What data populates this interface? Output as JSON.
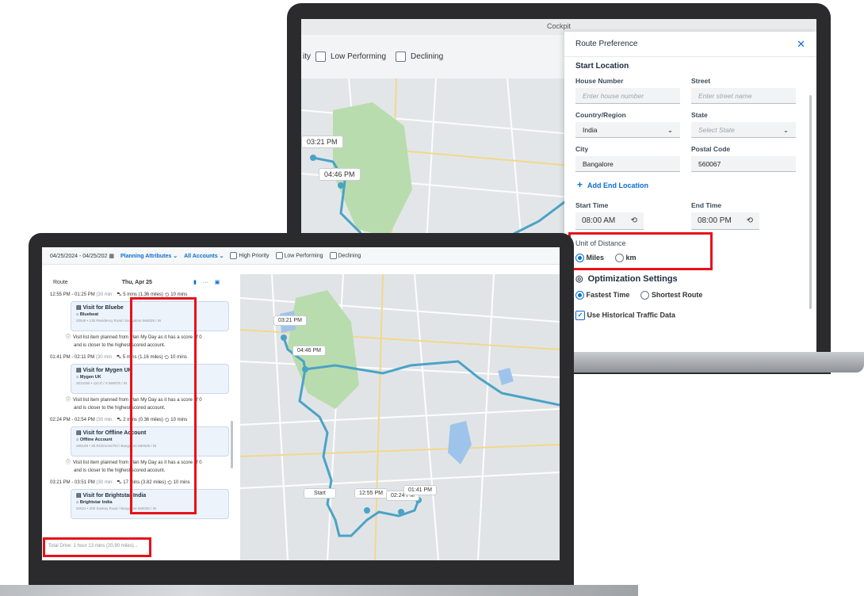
{
  "back": {
    "window_title": "Cockpit",
    "filters": [
      "ity",
      "Low Performing",
      "Declining"
    ],
    "map_pins": [
      "03:21 PM",
      "04:46 PM"
    ],
    "panel": {
      "title": "Route Preference",
      "close_icon": "close-icon",
      "start_location": "Start Location",
      "house_number_label": "House Number",
      "house_number_placeholder": "Enter house number",
      "street_label": "Street",
      "street_placeholder": "Enter street name",
      "country_label": "Country/Region",
      "country_value": "India",
      "state_label": "State",
      "state_placeholder": "Select State",
      "city_label": "City",
      "city_value": "Bangalore",
      "postal_label": "Postal Code",
      "postal_value": "560067",
      "add_end": "Add End Location",
      "start_time_label": "Start Time",
      "start_time_value": "08:00 AM",
      "end_time_label": "End Time",
      "end_time_value": "08:00 PM",
      "unit_label": "Unit of Distance",
      "unit_miles": "Miles",
      "unit_km": "km",
      "unit_selected": "Miles",
      "opt_title": "Optimization Settings",
      "fastest": "Fastest Time",
      "shortest": "Shortest Route",
      "opt_selected": "Fastest Time",
      "historical": "Use Historical Traffic Data",
      "historical_checked": true
    }
  },
  "front": {
    "toolbar": {
      "date_range": "04/25/2024 - 04/25/202",
      "planning": "Planning Attributes",
      "accounts": "All Accounts",
      "high": "High Priority",
      "low": "Low Performing",
      "declining": "Declining"
    },
    "route": {
      "label": "Route",
      "date": "Thu, Apr 25",
      "segments": [
        {
          "time": "12:55 PM - 01:25 PM",
          "dur": "(30 min",
          "drive": "5 mins (1.36 miles)",
          "wait": "10 mins",
          "title": "Visit for Bluebe",
          "account": "Bluebeat",
          "addr": "20546 • 135 Residency Road / Bangalore 560025 / IN",
          "note1": "Visit list item planned from Plan My Day as it has a score of 0",
          "note2": "and is closer to the highest scored account."
        },
        {
          "time": "01:41 PM - 02:11 PM",
          "dur": "(30 min",
          "drive": "5 mins (1.16 miles)",
          "wait": "10 mins",
          "title": "Visit for Mygen UK",
          "account": "Mygen UK",
          "addr": "3012250 • 110 E / S 560076 / IN",
          "note1": "Visit list item planned from Plan My Day as it has a score of 0",
          "note2": "and is closer to the highest scored account."
        },
        {
          "time": "02:24 PM - 02:54 PM",
          "dur": "(30 min",
          "drive": "2 mins (0.36 miles)",
          "wait": "10 mins",
          "title": "Visit for Offline Account",
          "account": "Offline Account",
          "addr": "496108 • 28 Richmond Rd / Bangalore 560025 / IN",
          "note1": "Visit list item planned from Plan My Day as it has a score of 0",
          "note2": "and is closer to the highest scored account."
        },
        {
          "time": "03:21 PM - 03:51 PM",
          "dur": "(30 min",
          "drive": "17 mins (3.82 miles)",
          "wait": "10 mins",
          "title": "Visit for Brightstar India",
          "account": "Brightstar India",
          "addr": "32021 • 200 Sankey Road / Bangalore 560025 / IN",
          "note1": "",
          "note2": ""
        }
      ],
      "total": "Total Drive: 1 hour 13 mins (20.90 miles)..."
    },
    "map_pins": [
      "03:21 PM",
      "04:46 PM",
      "Start",
      "12:55 PM",
      "02:24 PM",
      "01:41 PM"
    ]
  },
  "colors": {
    "accent": "#0a6ed1",
    "route": "#4aa3c6",
    "highlight": "#e8101a",
    "park": "#b9dcae",
    "water": "#9fc4ec"
  }
}
